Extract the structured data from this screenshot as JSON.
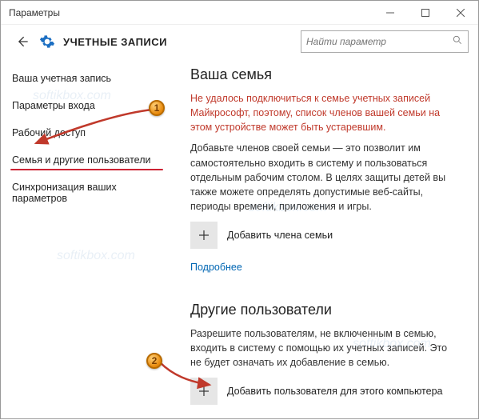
{
  "window": {
    "title": "Параметры"
  },
  "header": {
    "title": "УЧЕТНЫЕ ЗАПИСИ"
  },
  "search": {
    "placeholder": "Найти параметр"
  },
  "sidebar": {
    "items": [
      {
        "label": "Ваша учетная запись"
      },
      {
        "label": "Параметры входа"
      },
      {
        "label": "Рабочий доступ"
      },
      {
        "label": "Семья и другие пользователи"
      },
      {
        "label": "Синхронизация ваших параметров"
      }
    ],
    "active_index": 3
  },
  "main": {
    "family": {
      "heading": "Ваша семья",
      "warning": "Не удалось подключиться к семье учетных записей Майкрософт, поэтому, список членов вашей семьи на этом устройстве может быть устаревшим.",
      "description": "Добавьте членов своей семьи — это позволит им самостоятельно входить в систему и пользоваться отдельным рабочим столом. В целях защиты детей вы также можете определять допустимые веб-сайты, периоды времени, приложения и игры.",
      "add_label": "Добавить члена семьи",
      "link": "Подробнее"
    },
    "others": {
      "heading": "Другие пользователи",
      "description": "Разрешите пользователям, не включенным в семью, входить в систему с помощью их учетных записей. Это не будет означать их добавление в семью.",
      "add_label": "Добавить пользователя для этого компьютера"
    }
  },
  "annotations": {
    "marker1": "1",
    "marker2": "2"
  },
  "watermark": "softikbox.com"
}
